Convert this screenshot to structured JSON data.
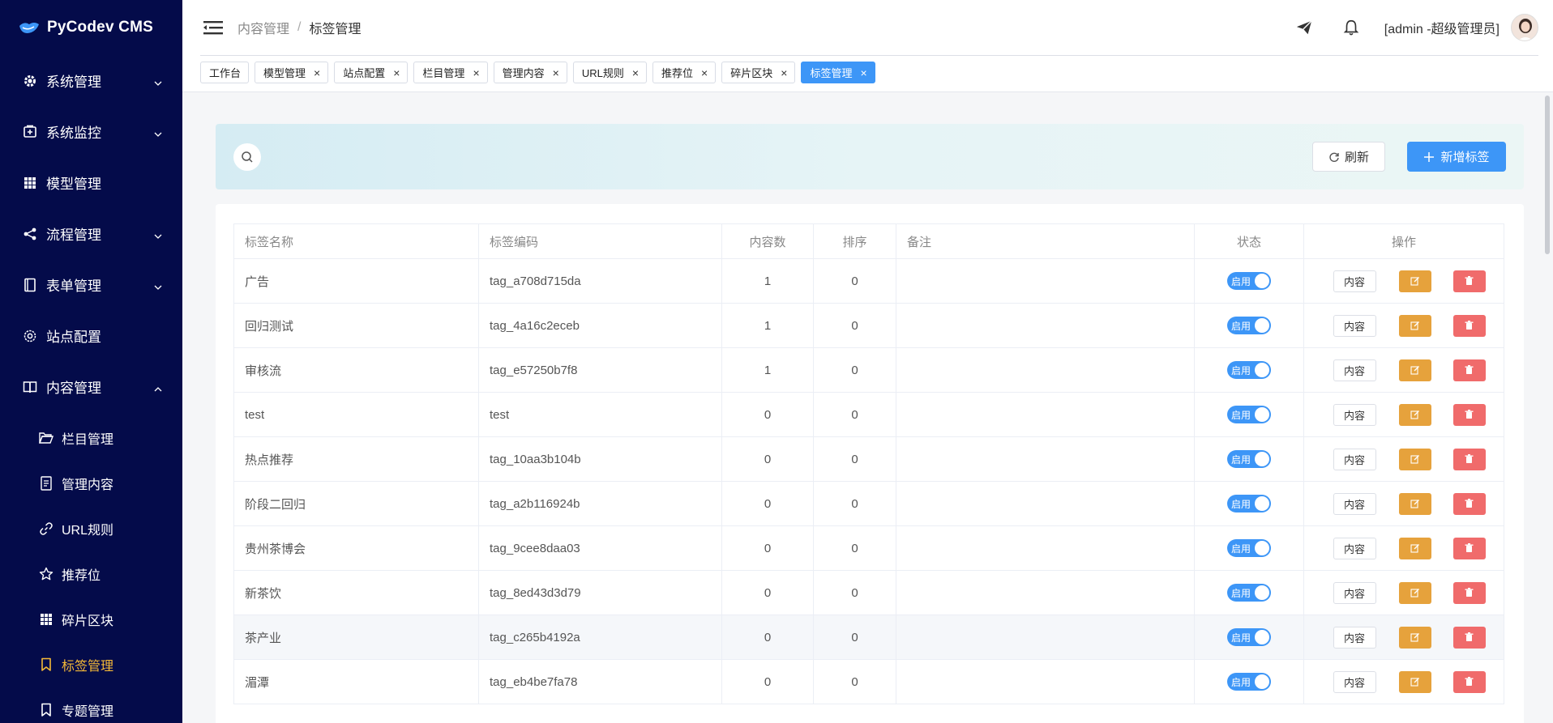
{
  "app": {
    "name": "PyCodev CMS"
  },
  "sidebar": {
    "items": [
      {
        "label": "系统管理",
        "icon": "gear-icon",
        "expandable": true
      },
      {
        "label": "系统监控",
        "icon": "monitor-icon",
        "expandable": true
      },
      {
        "label": "模型管理",
        "icon": "grid-icon",
        "expandable": false
      },
      {
        "label": "流程管理",
        "icon": "share-icon",
        "expandable": true
      },
      {
        "label": "表单管理",
        "icon": "form-icon",
        "expandable": true
      },
      {
        "label": "站点配置",
        "icon": "settings-icon",
        "expandable": false
      },
      {
        "label": "内容管理",
        "icon": "book-icon",
        "expandable": true,
        "expanded": true
      }
    ],
    "sub_items": [
      {
        "label": "栏目管理",
        "icon": "folder-icon"
      },
      {
        "label": "管理内容",
        "icon": "document-icon"
      },
      {
        "label": "URL规则",
        "icon": "link-icon"
      },
      {
        "label": "推荐位",
        "icon": "star-icon"
      },
      {
        "label": "碎片区块",
        "icon": "grid-icon"
      },
      {
        "label": "标签管理",
        "icon": "bookmark-icon",
        "active": true
      },
      {
        "label": "专题管理",
        "icon": "bookmark-icon"
      }
    ]
  },
  "header": {
    "breadcrumb": [
      "内容管理",
      "标签管理"
    ],
    "user": "[admin -超级管理员]"
  },
  "tabs": [
    {
      "label": "工作台",
      "closable": false
    },
    {
      "label": "模型管理",
      "closable": true
    },
    {
      "label": "站点配置",
      "closable": true
    },
    {
      "label": "栏目管理",
      "closable": true
    },
    {
      "label": "管理内容",
      "closable": true
    },
    {
      "label": "URL规则",
      "closable": true
    },
    {
      "label": "推荐位",
      "closable": true
    },
    {
      "label": "碎片区块",
      "closable": true
    },
    {
      "label": "标签管理",
      "closable": true,
      "active": true
    }
  ],
  "toolbar": {
    "refresh_label": "刷新",
    "add_label": "新增标签"
  },
  "table": {
    "columns": [
      "标签名称",
      "标签编码",
      "内容数",
      "排序",
      "备注",
      "状态",
      "操作"
    ],
    "rows": [
      {
        "name": "广告",
        "code": "tag_a708d715da",
        "count": "1",
        "sort": "0",
        "remark": "",
        "status": "启用"
      },
      {
        "name": "回归测试",
        "code": "tag_4a16c2eceb",
        "count": "1",
        "sort": "0",
        "remark": "",
        "status": "启用"
      },
      {
        "name": "审核流",
        "code": "tag_e57250b7f8",
        "count": "1",
        "sort": "0",
        "remark": "",
        "status": "启用"
      },
      {
        "name": "test",
        "code": "test",
        "count": "0",
        "sort": "0",
        "remark": "",
        "status": "启用"
      },
      {
        "name": "热点推荐",
        "code": "tag_10aa3b104b",
        "count": "0",
        "sort": "0",
        "remark": "",
        "status": "启用"
      },
      {
        "name": "阶段二回归",
        "code": "tag_a2b116924b",
        "count": "0",
        "sort": "0",
        "remark": "",
        "status": "启用"
      },
      {
        "name": "贵州茶博会",
        "code": "tag_9cee8daa03",
        "count": "0",
        "sort": "0",
        "remark": "",
        "status": "启用"
      },
      {
        "name": "新茶饮",
        "code": "tag_8ed43d3d79",
        "count": "0",
        "sort": "0",
        "remark": "",
        "status": "启用"
      },
      {
        "name": "茶产业",
        "code": "tag_c265b4192a",
        "count": "0",
        "sort": "0",
        "remark": "",
        "status": "启用"
      },
      {
        "name": "湄潭",
        "code": "tag_eb4be7fa78",
        "count": "0",
        "sort": "0",
        "remark": "",
        "status": "启用"
      }
    ],
    "op_content_label": "内容"
  },
  "colors": {
    "sidebar_bg": "#040b4a",
    "accent": "#3d96f7",
    "active_menu": "#f5b937",
    "edit": "#e6a23c",
    "delete": "#f06b6b"
  }
}
